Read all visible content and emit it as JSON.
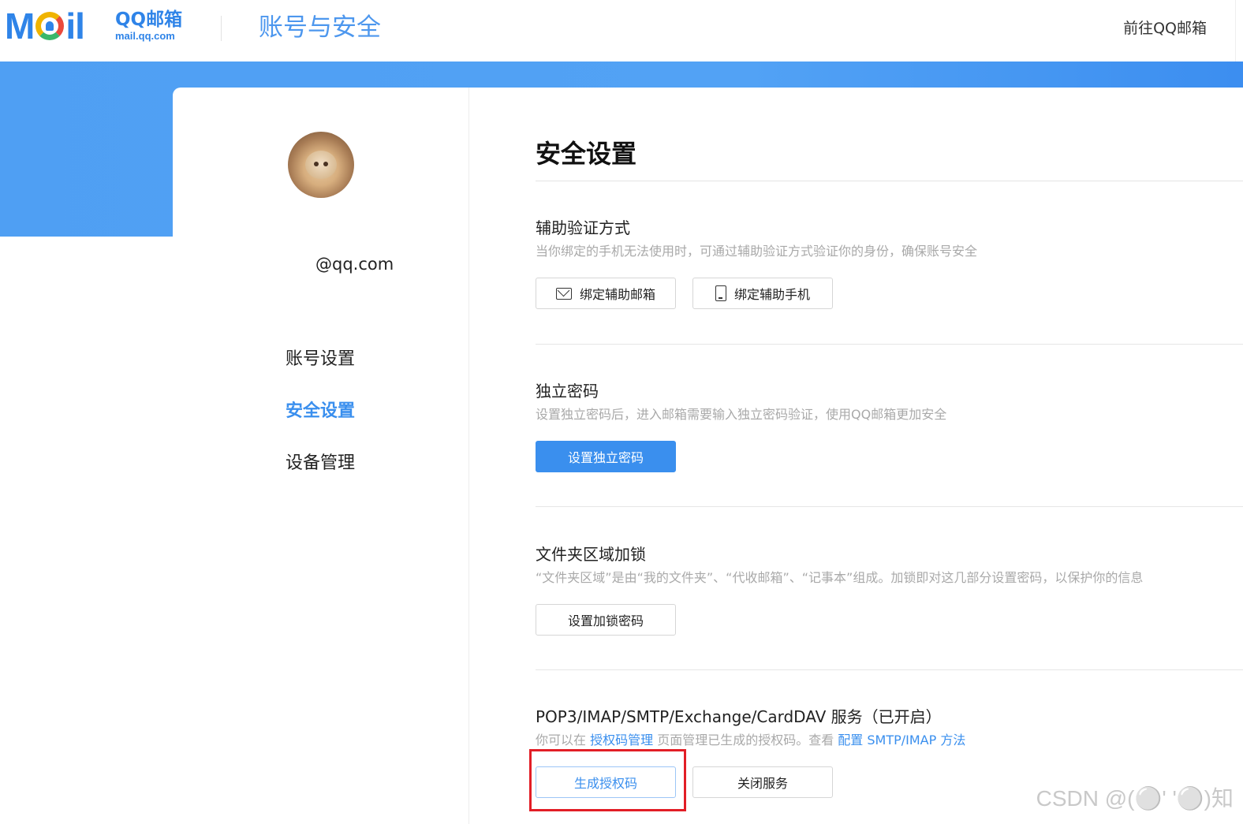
{
  "header": {
    "logo_word": "Mail",
    "logo_title": "QQ邮箱",
    "logo_sub": "mail.qq.com",
    "title": "账号与安全",
    "goto_link": "前往QQ邮箱"
  },
  "sidebar": {
    "email": "@qq.com",
    "items": [
      {
        "label": "账号设置",
        "active": false
      },
      {
        "label": "安全设置",
        "active": true
      },
      {
        "label": "设备管理",
        "active": false
      }
    ]
  },
  "main": {
    "title": "安全设置",
    "sections": [
      {
        "title": "辅助验证方式",
        "desc": "当你绑定的手机无法使用时，可通过辅助验证方式验证你的身份，确保账号安全",
        "buttons": [
          {
            "label": "绑定辅助邮箱",
            "icon": "mail-icon"
          },
          {
            "label": "绑定辅助手机",
            "icon": "phone-icon"
          }
        ]
      },
      {
        "title": "独立密码",
        "desc": "设置独立密码后，进入邮箱需要输入独立密码验证，使用QQ邮箱更加安全",
        "buttons": [
          {
            "label": "设置独立密码",
            "style": "primary"
          }
        ]
      },
      {
        "title": "文件夹区域加锁",
        "desc": "“文件夹区域”是由“我的文件夹”、“代收邮箱”、“记事本”组成。加锁即对这几部分设置密码，以保护你的信息",
        "buttons": [
          {
            "label": "设置加锁密码"
          }
        ]
      },
      {
        "title": "POP3/IMAP/SMTP/Exchange/CardDAV 服务（已开启）",
        "desc_parts": [
          {
            "text": "你可以在 "
          },
          {
            "text": "授权码管理",
            "link": true
          },
          {
            "text": " 页面管理已生成的授权码。查看 "
          },
          {
            "text": "配置 SMTP/IMAP 方法",
            "link": true
          }
        ],
        "buttons": [
          {
            "label": "生成授权码",
            "style": "outline-blue"
          },
          {
            "label": "关闭服务"
          }
        ]
      }
    ]
  },
  "colors": {
    "accent": "#3a8fee",
    "band": "#52a2f5",
    "highlight": "#e21e26"
  },
  "watermark": "CSDN @(⚪' '⚪)知"
}
